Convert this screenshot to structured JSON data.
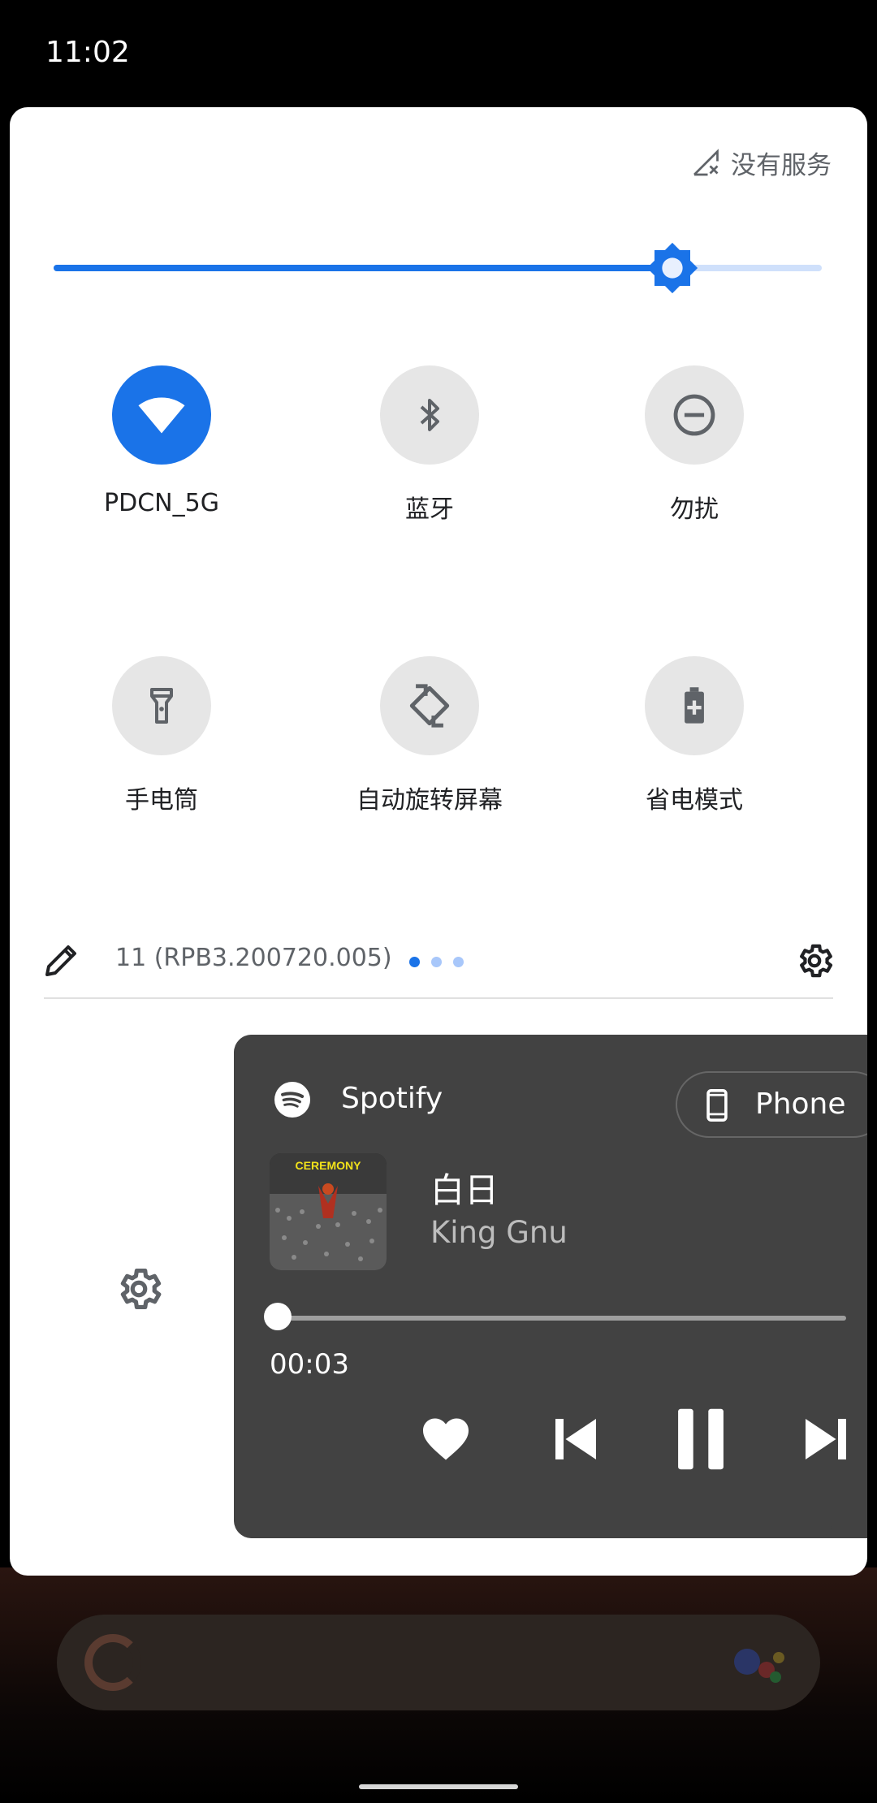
{
  "status_bar": {
    "time": "11:02"
  },
  "quick_settings": {
    "carrier_status": "没有服务",
    "brightness_level_fraction": 0.805,
    "tiles": [
      {
        "label": "PDCN_5G",
        "icon": "wifi-icon",
        "active": true
      },
      {
        "label": "蓝牙",
        "icon": "bluetooth-icon",
        "active": false
      },
      {
        "label": "勿扰",
        "icon": "do-not-disturb-icon",
        "active": false
      },
      {
        "label": "手电筒",
        "icon": "flashlight-icon",
        "active": false
      },
      {
        "label": "自动旋转屏幕",
        "icon": "auto-rotate-icon",
        "active": false
      },
      {
        "label": "省电模式",
        "icon": "battery-saver-icon",
        "active": false
      }
    ],
    "build_number": "11 (RPB3.200720.005)",
    "pages": {
      "count": 3,
      "current": 1
    }
  },
  "media": {
    "app_name": "Spotify",
    "output_device": "Phone",
    "album_art_text": "CEREMONY",
    "title": "白日",
    "artist": "King Gnu",
    "elapsed": "00:03",
    "progress_fraction": 0.01
  },
  "colors": {
    "accent": "#1a73e8",
    "tile_inactive": "#e6e6e6",
    "media_bg": "#424242"
  }
}
